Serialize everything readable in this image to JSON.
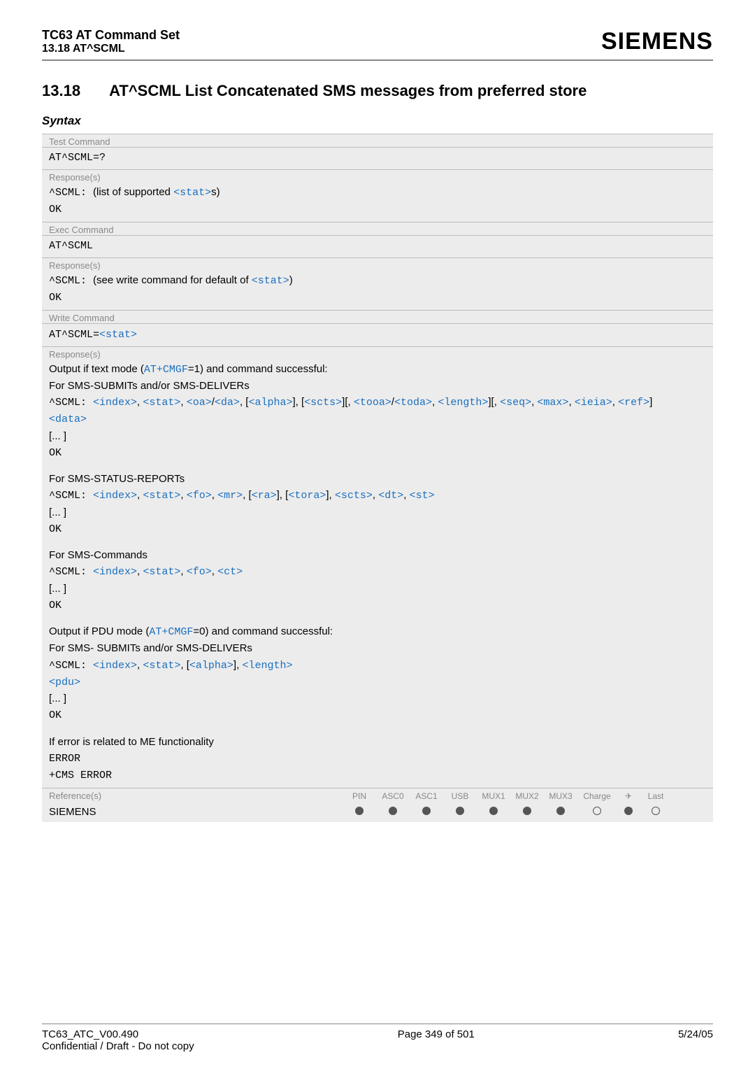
{
  "header": {
    "title": "TC63 AT Command Set",
    "subtitle": "13.18 AT^SCML",
    "brand": "SIEMENS"
  },
  "section": {
    "number": "13.18",
    "title": "AT^SCML   List Concatenated SMS messages from preferred store"
  },
  "syntax_label": "Syntax",
  "blocks": {
    "test_label": "Test Command",
    "test_cmd": "AT^SCML=?",
    "test_resp_label": "Response(s)",
    "test_resp_prefix": "^SCML: ",
    "test_resp_text": "(list of supported ",
    "test_resp_param": "<stat>",
    "test_resp_suffix": "s)",
    "ok": "OK",
    "exec_label": "Exec Command",
    "exec_cmd": "AT^SCML",
    "exec_resp_label": "Response(s)",
    "exec_resp_prefix": "^SCML: ",
    "exec_resp_text": "(see write command for default of ",
    "exec_resp_param": "<stat>",
    "exec_resp_suffix": ")",
    "write_label": "Write Command",
    "write_cmd_prefix": "AT^SCML=",
    "write_cmd_param": "<stat>",
    "write_resp_label": "Response(s)",
    "out_text1a": "Output if text mode (",
    "out_text1_cmd": "AT+CMGF",
    "out_text1b": "=1) and command successful:",
    "out_text2": "For SMS-SUBMITs and/or SMS-DELIVERs",
    "scml_prefix": "^SCML: ",
    "line3": {
      "p1": "<index>",
      "p2": "<stat>",
      "p3": "<oa>",
      "p4": "<da>",
      "p5": "<alpha>",
      "p6": "<scts>",
      "p7": "<tooa>",
      "p8": "<toda>",
      "p9": "<length>",
      "p10": "<seq>",
      "p11": "<max>",
      "p12": "<ieia>",
      "p13": "<ref>"
    },
    "data_param": "<data>",
    "ellipsis": "[... ]",
    "status_label": "For SMS-STATUS-REPORTs",
    "status_line": {
      "p1": "<index>",
      "p2": "<stat>",
      "p3": "<fo>",
      "p4": "<mr>",
      "p5": "<ra>",
      "p6": "<tora>",
      "p7": "<scts>",
      "p8": "<dt>",
      "p9": "<st>"
    },
    "cmds_label": "For SMS-Commands",
    "cmds_line": {
      "p1": "<index>",
      "p2": "<stat>",
      "p3": "<fo>",
      "p4": "<ct>"
    },
    "pdu1a": "Output if PDU mode (",
    "pdu1_cmd": "AT+CMGF",
    "pdu1b": "=0) and command successful:",
    "pdu2": "For SMS- SUBMITs and/or SMS-DELIVERs",
    "pdu_line": {
      "p1": "<index>",
      "p2": "<stat>",
      "p3": "<alpha>",
      "p4": "<length>"
    },
    "pdu_param": "<pdu>",
    "err1": "If error is related to ME functionality",
    "err2": "ERROR",
    "err3": "+CMS ERROR"
  },
  "ref": {
    "label": "Reference(s)",
    "cols": [
      "PIN",
      "ASC0",
      "ASC1",
      "USB",
      "MUX1",
      "MUX2",
      "MUX3",
      "Charge",
      "✈",
      "Last"
    ],
    "siemens": "SIEMENS",
    "dots": [
      "f",
      "f",
      "f",
      "f",
      "f",
      "f",
      "f",
      "e",
      "f",
      "e"
    ]
  },
  "footer": {
    "left1": "TC63_ATC_V00.490",
    "left2": "Confidential / Draft - Do not copy",
    "center": "Page 349 of 501",
    "right": "5/24/05"
  }
}
